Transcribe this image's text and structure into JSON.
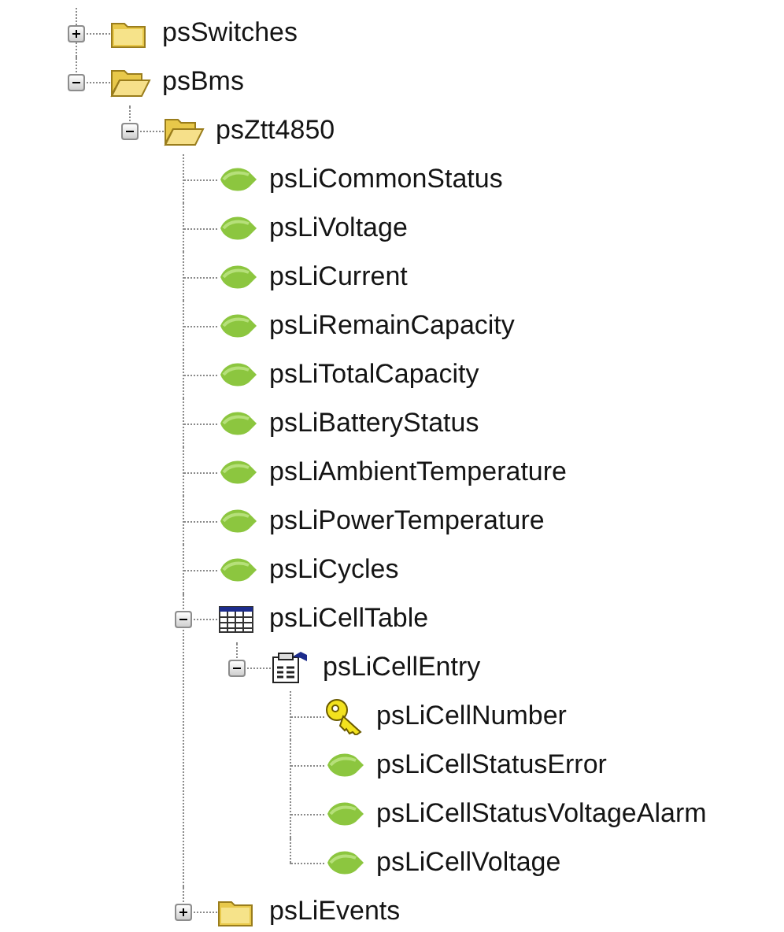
{
  "tree": [
    {
      "kind": "folder",
      "label": "psSwitches",
      "expanded": false
    },
    {
      "kind": "folder",
      "label": "psBms",
      "expanded": true,
      "children": [
        {
          "kind": "folder",
          "label": "psZtt4850",
          "expanded": true,
          "children": [
            {
              "kind": "leaf",
              "label": "psLiCommonStatus"
            },
            {
              "kind": "leaf",
              "label": "psLiVoltage"
            },
            {
              "kind": "leaf",
              "label": "psLiCurrent"
            },
            {
              "kind": "leaf",
              "label": "psLiRemainCapacity"
            },
            {
              "kind": "leaf",
              "label": "psLiTotalCapacity"
            },
            {
              "kind": "leaf",
              "label": "psLiBatteryStatus"
            },
            {
              "kind": "leaf",
              "label": "psLiAmbientTemperature"
            },
            {
              "kind": "leaf",
              "label": "psLiPowerTemperature"
            },
            {
              "kind": "leaf",
              "label": "psLiCycles"
            },
            {
              "kind": "table",
              "label": "psLiCellTable",
              "expanded": true,
              "children": [
                {
                  "kind": "entry",
                  "label": "psLiCellEntry",
                  "expanded": true,
                  "children": [
                    {
                      "kind": "key",
                      "label": "psLiCellNumber"
                    },
                    {
                      "kind": "leaf",
                      "label": "psLiCellStatusError"
                    },
                    {
                      "kind": "leaf",
                      "label": "psLiCellStatusVoltageAlarm"
                    },
                    {
                      "kind": "leaf",
                      "label": "psLiCellVoltage"
                    }
                  ]
                }
              ]
            },
            {
              "kind": "folder",
              "label": "psLiEvents",
              "expanded": false
            }
          ]
        }
      ]
    }
  ]
}
